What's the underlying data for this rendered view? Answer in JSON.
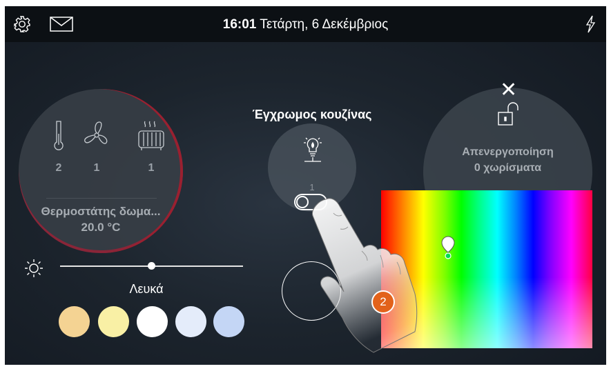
{
  "header": {
    "time": "16:01",
    "date": "Τετάρτη, 6 Δεκέμβριος",
    "icons": [
      "gear-icon",
      "envelope-icon",
      "lightning-icon"
    ]
  },
  "thermostat": {
    "counts": [
      "2",
      "1",
      "1"
    ],
    "icons": [
      "thermometer-icon",
      "fan-icon",
      "radiator-icon"
    ],
    "name": "Θερμοστάτης δωμα...",
    "temperature": "20.0 °C"
  },
  "color_light": {
    "title": "Έγχρωμος κουζίνας",
    "count": "1",
    "toggle_on": false
  },
  "lock": {
    "line1": "Απενεργοποίηση",
    "line2": "0 χωρίσματα"
  },
  "brightness": {
    "level": 0.5
  },
  "white_label": "Λευκά",
  "swatches": [
    "#f4d393",
    "#f9f0a5",
    "#ffffff",
    "#e4ecfa",
    "#c4d6f5"
  ],
  "step_badge": "2"
}
